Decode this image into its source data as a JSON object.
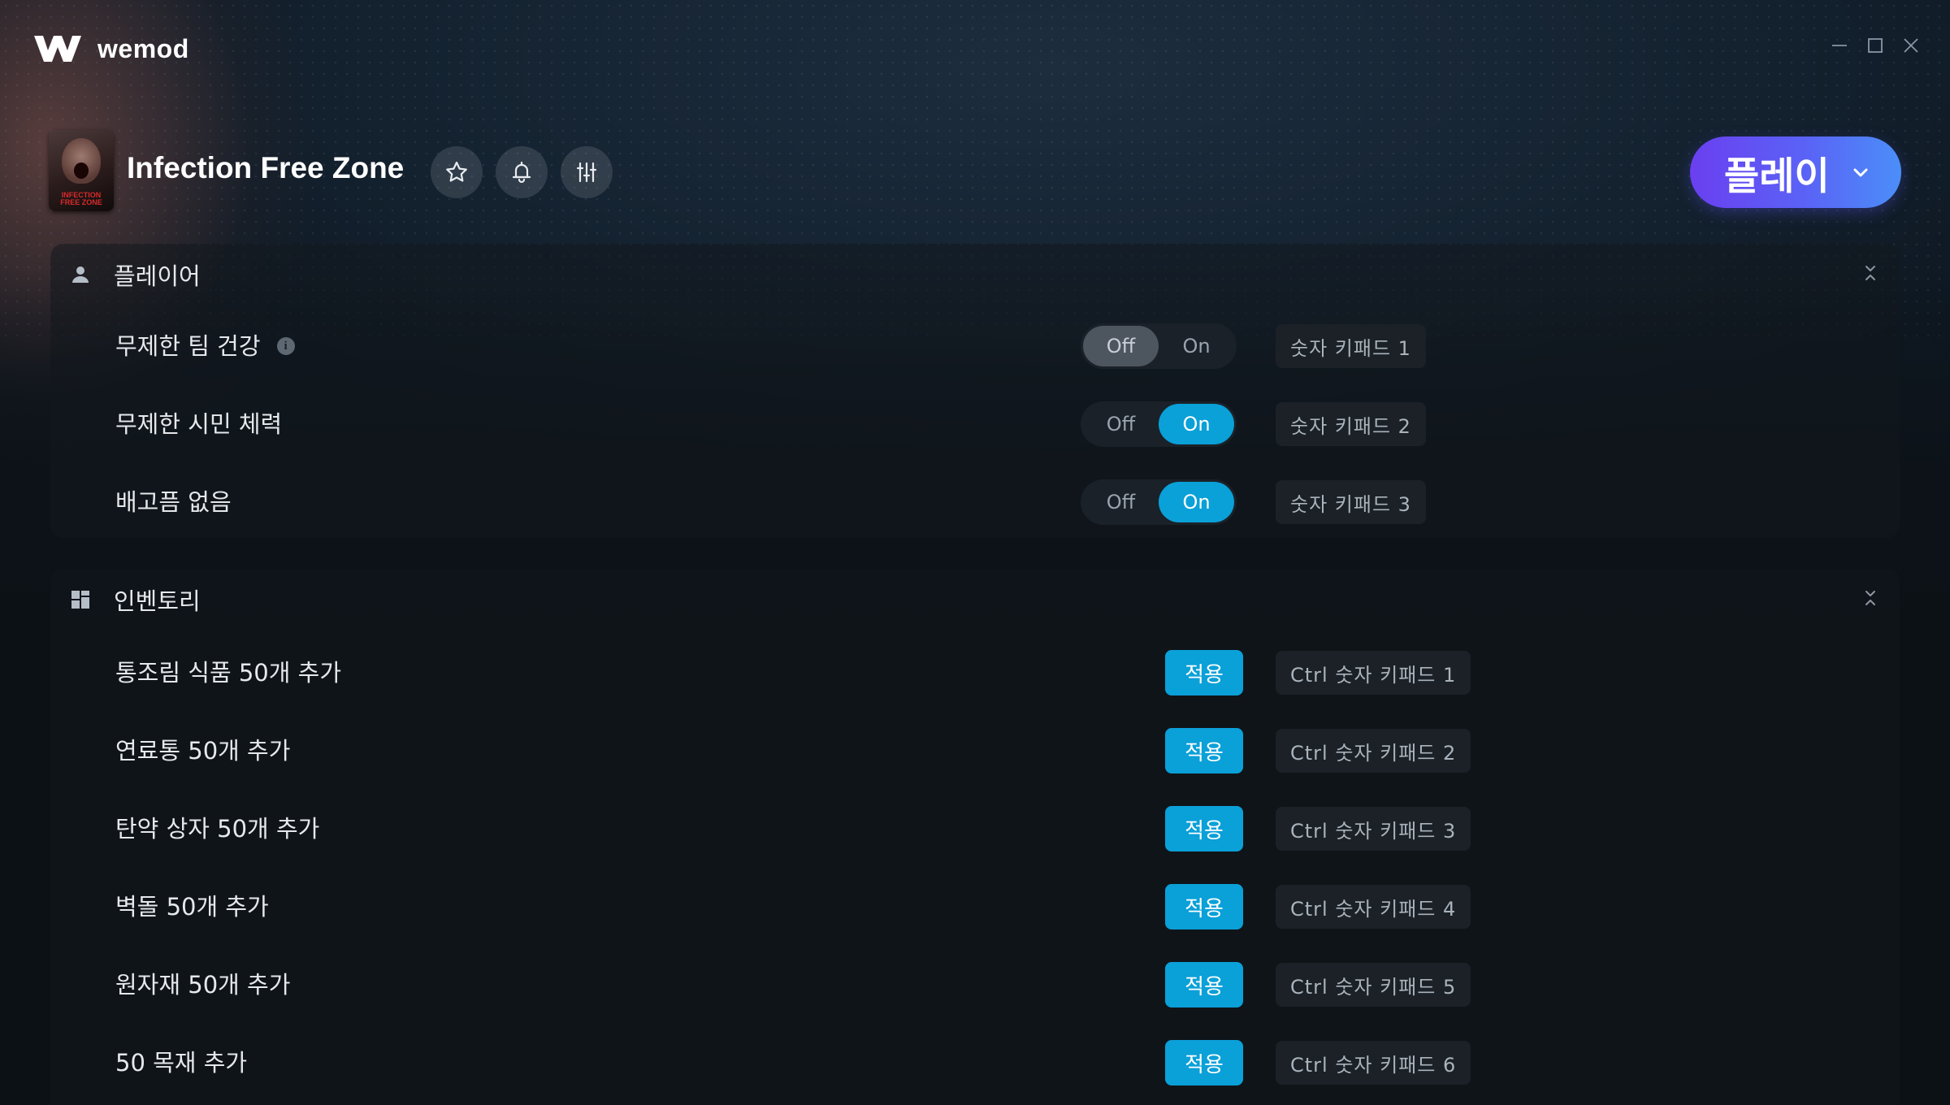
{
  "app": {
    "name": "wemod",
    "window_controls": [
      "minimize-icon",
      "maximize-icon",
      "close-icon"
    ]
  },
  "game": {
    "title": "Infection Free Zone",
    "thumbnail_text": "INFECTION FREE ZONE",
    "header_icons": [
      "star-icon",
      "bell-icon",
      "sliders-icon"
    ]
  },
  "play": {
    "label": "플레이",
    "gradient": [
      "#6a3ff0",
      "#4b8ef8"
    ]
  },
  "sections": {
    "player": {
      "title": "플레이어",
      "icon": "person-icon",
      "rows": [
        {
          "label": "무제한 팀 건강",
          "has_info": true,
          "off": "Off",
          "on": "On",
          "state": "Off",
          "hotkey": "숫자 키패드 1"
        },
        {
          "label": "무제한 시민 체력",
          "has_info": false,
          "off": "Off",
          "on": "On",
          "state": "On",
          "hotkey": "숫자 키패드 2"
        },
        {
          "label": "배고픔 없음",
          "has_info": false,
          "off": "Off",
          "on": "On",
          "state": "On",
          "hotkey": "숫자 키패드 3"
        }
      ]
    },
    "inventory": {
      "title": "인벤토리",
      "icon": "grid-icon",
      "apply_label": "적용",
      "rows": [
        {
          "label": "통조림 식품 50개 추가",
          "hotkey": "Ctrl 숫자 키패드 1"
        },
        {
          "label": "연료통 50개 추가",
          "hotkey": "Ctrl 숫자 키패드 2"
        },
        {
          "label": "탄약 상자 50개 추가",
          "hotkey": "Ctrl 숫자 키패드 3"
        },
        {
          "label": "벽돌 50개 추가",
          "hotkey": "Ctrl 숫자 키패드 4"
        },
        {
          "label": "원자재 50개 추가",
          "hotkey": "Ctrl 숫자 키패드 5"
        },
        {
          "label": "50 목재 추가",
          "hotkey": "Ctrl 숫자 키패드 6"
        }
      ]
    }
  },
  "colors": {
    "accent": "#0aa0d8",
    "background": "#0c1116"
  }
}
